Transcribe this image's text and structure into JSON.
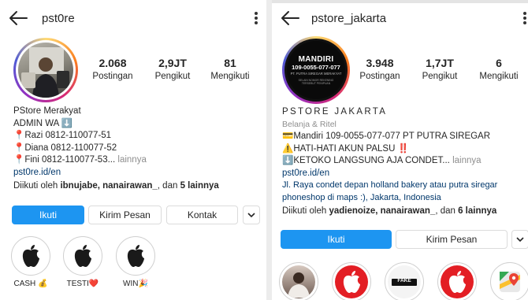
{
  "left": {
    "username": "pst0re",
    "stats": [
      {
        "value": "2.068",
        "label": "Postingan"
      },
      {
        "value": "2,9JT",
        "label": "Pengikut"
      },
      {
        "value": "81",
        "label": "Mengikuti"
      }
    ],
    "name": "PStore Merakyat",
    "admin": "ADMIN WA ⬇️",
    "contacts": [
      "📍Razi 0812-110077-51",
      "📍Diana 0812-110077-52",
      "📍Fini 0812-110077-53..."
    ],
    "more": "lainnya",
    "link": "pst0re.id/en",
    "followed_prefix": "Diikuti oleh ",
    "followed_names": "ibnujabe, nanairawan_",
    "followed_mid": ", dan ",
    "followed_count": "5 lainnya",
    "buttons": {
      "follow": "Ikuti",
      "message": "Kirim Pesan",
      "contact": "Kontak"
    },
    "highlights": [
      {
        "label": "CASH 💰",
        "icon": "apple-icon"
      },
      {
        "label": "TESTI❤️",
        "icon": "apple-icon"
      },
      {
        "label": "WIN🎉",
        "icon": "apple-icon"
      }
    ]
  },
  "right": {
    "username": "pstore_jakarta",
    "avatar_title": "MANDIRI",
    "avatar_number": "109-0055-077-077",
    "avatar_company": "PT. PUTRA SIREGAR MERAKYAT",
    "avatar_note": "SELAIN NOMOR REKENING TERSEBUT PENIPUAN",
    "stats": [
      {
        "value": "3.948",
        "label": "Postingan"
      },
      {
        "value": "1,7JT",
        "label": "Pengikut"
      },
      {
        "value": "6",
        "label": "Mengikuti"
      }
    ],
    "name": "PSTORE JAKARTA",
    "category": "Belanja & Ritel",
    "lines": [
      "💳Mandiri 109-0055-077-077 PT PUTRA SIREGAR",
      "⚠️HATI-HATI AKUN PALSU ‼️",
      "⬇️KETOKO LANGSUNG AJA CONDET..."
    ],
    "more": "lainnya",
    "link": "pst0re.id/en",
    "address1": "Jl. Raya condet depan holland bakery atau putra siregar",
    "address2": "phoneshop di maps :), Jakarta, Indonesia",
    "followed_prefix": "Diikuti oleh ",
    "followed_names": "yadienoize, nanairawan_",
    "followed_mid": ", dan ",
    "followed_count": "6 lainnya",
    "buttons": {
      "follow": "Ikuti",
      "message": "Kirim Pesan"
    },
    "highlight_fake": "FAKE"
  },
  "colors": {
    "primary_button": "#1d95f1",
    "link": "#00376b",
    "muted": "#8e8e8e"
  }
}
